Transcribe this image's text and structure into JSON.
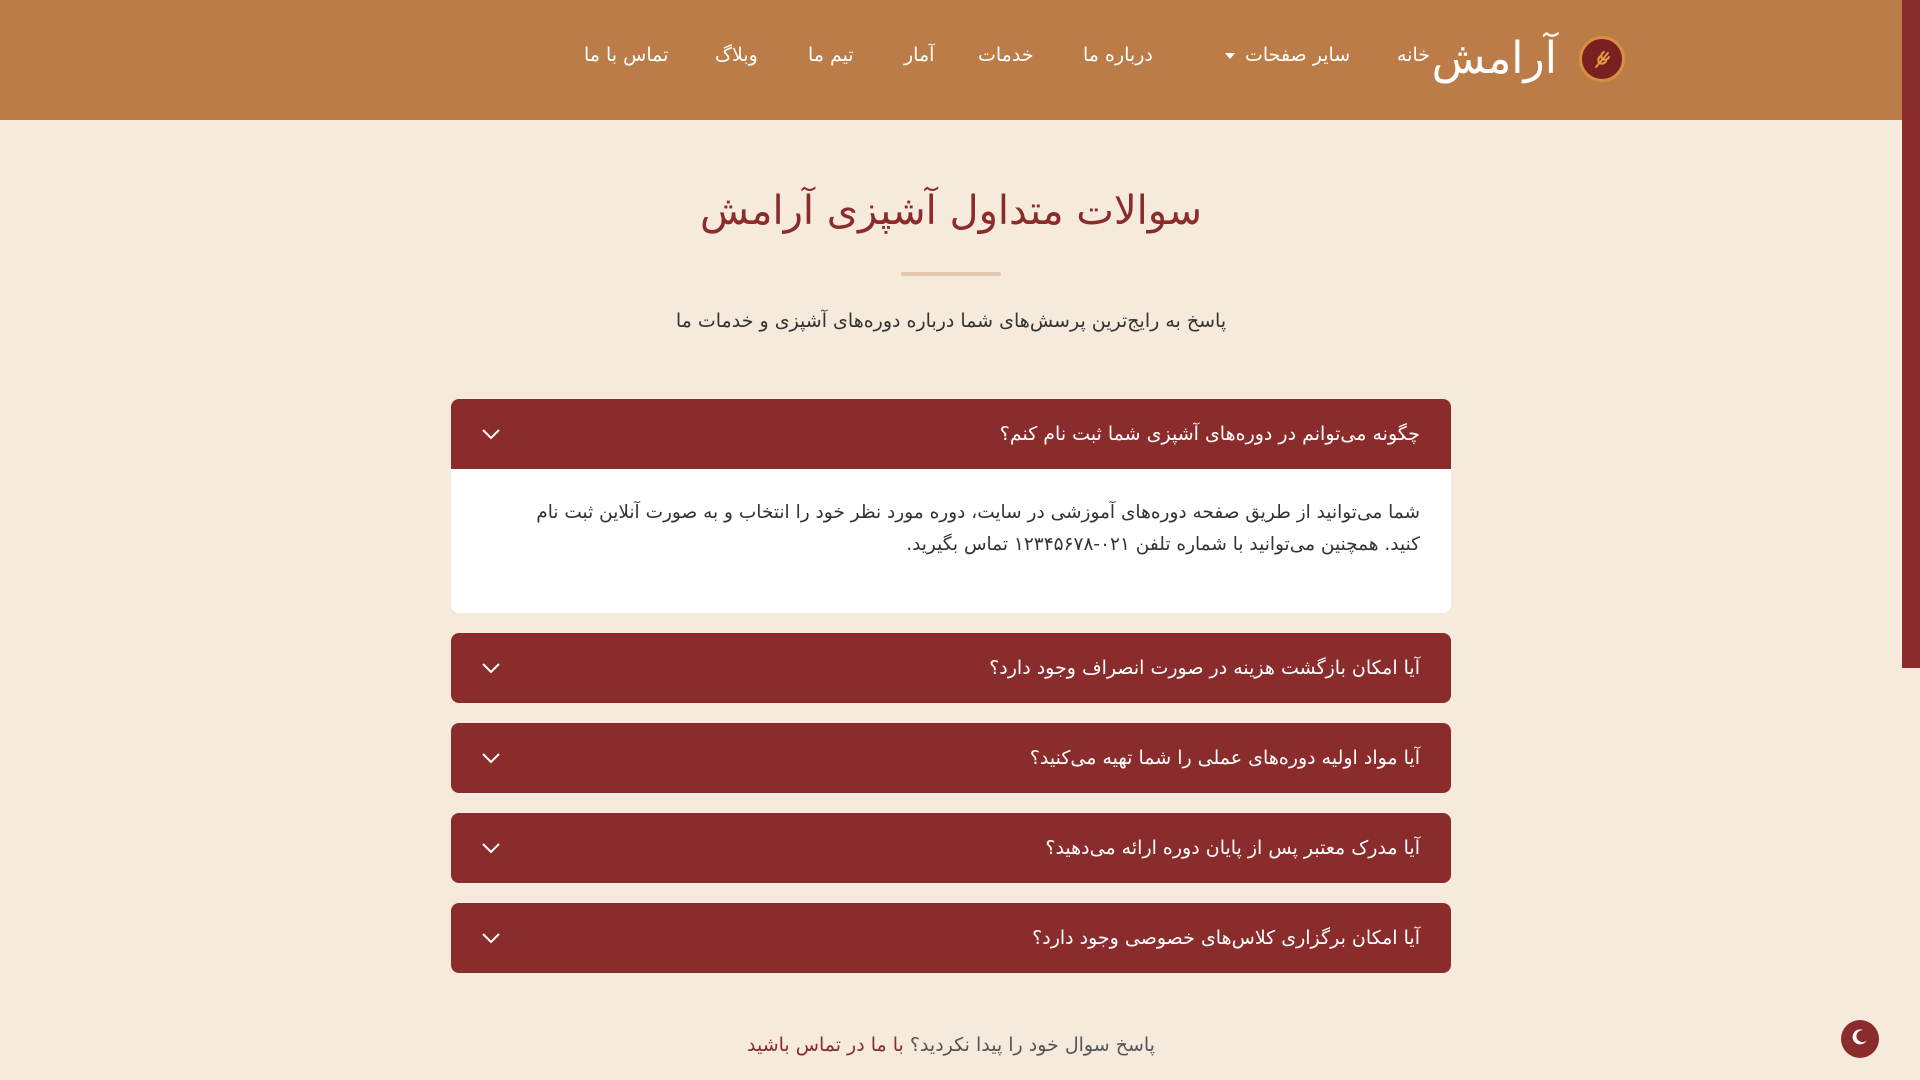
{
  "header": {
    "brand": "آرامش",
    "nav": [
      {
        "label": "خانه"
      },
      {
        "label": "سایر صفحات",
        "dropdown": true
      },
      {
        "label": "درباره ما"
      },
      {
        "label": "خدمات"
      },
      {
        "label": "آمار"
      },
      {
        "label": "تیم ما"
      },
      {
        "label": "وبلاگ"
      },
      {
        "label": "تماس با ما"
      }
    ]
  },
  "page": {
    "title": "سوالات متداول آشپزی آرامش",
    "subtitle": "پاسخ به رایج‌ترین پرسش‌های شما درباره دوره‌های آشپزی و خدمات ما"
  },
  "faq": [
    {
      "question": "چگونه می‌توانم در دوره‌های آشپزی شما ثبت نام کنم؟",
      "answer": "شما می‌توانید از طریق صفحه دوره‌های آموزشی در سایت، دوره مورد نظر خود را انتخاب و به صورت آنلاین ثبت نام کنید. همچنین می‌توانید با شماره تلفن ۰۲۱-۱۲۳۴۵۶۷۸ تماس بگیرید.",
      "open": true
    },
    {
      "question": "آیا امکان بازگشت هزینه در صورت انصراف وجود دارد؟",
      "open": false
    },
    {
      "question": "آیا مواد اولیه دوره‌های عملی را شما تهیه می‌کنید؟",
      "open": false
    },
    {
      "question": "آیا مدرک معتبر پس از پایان دوره ارائه می‌دهید؟",
      "open": false
    },
    {
      "question": "آیا امکان برگزاری کلاس‌های خصوصی وجود دارد؟",
      "open": false
    }
  ],
  "footer": {
    "question_text": "پاسخ سوال خود را پیدا نکردید؟",
    "contact_link": "با ما در تماس باشید"
  },
  "colors": {
    "header_bg": "#bc7c47",
    "page_bg": "#f5eadc",
    "accent": "#8b2c2c"
  },
  "icons": {
    "logo": "wheat-logo-icon",
    "faq_toggle": "chevron-down-icon",
    "theme_toggle": "moon-icon"
  }
}
